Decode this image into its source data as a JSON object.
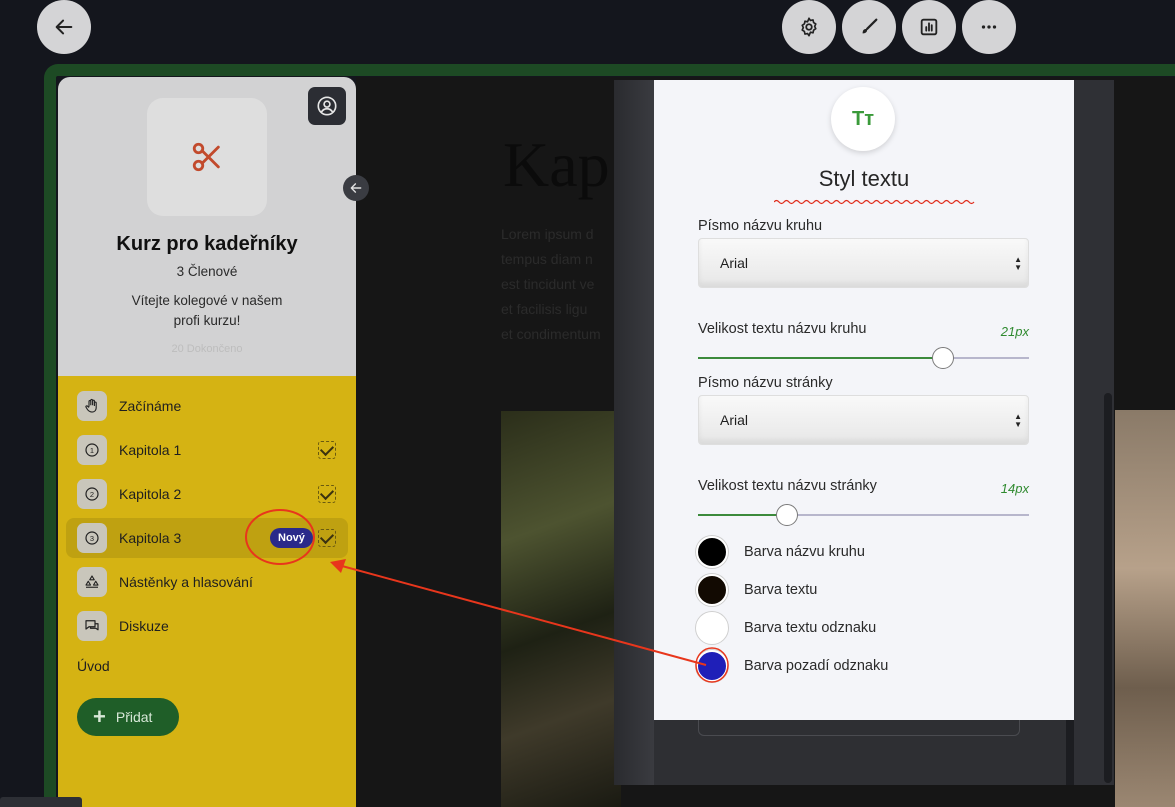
{
  "toolbar": {
    "back_icon": "arrow-left-icon",
    "buttons": [
      {
        "name": "settings-button",
        "icon": "gear-icon"
      },
      {
        "name": "design-button",
        "icon": "brush-icon"
      },
      {
        "name": "stats-button",
        "icon": "chart-icon"
      },
      {
        "name": "more-button",
        "icon": "more-icon"
      }
    ]
  },
  "sidebar": {
    "logo_icon": "scissors-icon",
    "title": "Kurz pro kadeřníky",
    "members": "3 Členové",
    "description": "Vítejte kolegové v našem profi kurzu!",
    "ghost_text": "20 Dokončeno",
    "items": [
      {
        "label": "Začínáme",
        "icon": "hand-icon",
        "checked": false
      },
      {
        "label": "Kapitola 1",
        "icon": "number-1-icon",
        "checked": true
      },
      {
        "label": "Kapitola 2",
        "icon": "number-2-icon",
        "checked": true
      },
      {
        "label": "Kapitola 3",
        "icon": "number-3-icon",
        "checked": true,
        "badge": "Nový",
        "active": true
      },
      {
        "label": "Nástěnky a hlasování",
        "icon": "voting-icon",
        "checked": false
      },
      {
        "label": "Diskuze",
        "icon": "chat-icon",
        "checked": false
      }
    ],
    "section": "Úvod",
    "add_label": "Přidat"
  },
  "content": {
    "title": "Kap",
    "lorem_lines": [
      "Lorem ipsum d",
      "tempus diam n",
      "est tincidunt ve",
      "et facilisis ligu",
      "et condimentum"
    ]
  },
  "modal": {
    "icon_text": "Tт",
    "title": "Styl textu",
    "circle_font_label": "Písmo názvu kruhu",
    "circle_font_value": "Arial",
    "circle_size_label": "Velikost textu názvu kruhu",
    "circle_size_value": "21px",
    "circle_size_fraction": 0.74,
    "page_font_label": "Písmo názvu stránky",
    "page_font_value": "Arial",
    "page_size_label": "Velikost textu názvu stránky",
    "page_size_value": "14px",
    "page_size_fraction": 0.27,
    "colors": [
      {
        "label": "Barva názvu kruhu",
        "color": "#000000"
      },
      {
        "label": "Barva textu",
        "color": "#120a02"
      },
      {
        "label": "Barva textu odznaku",
        "color": "#ffffff"
      },
      {
        "label": "Barva pozadí odznaku",
        "color": "#1f1fb8"
      }
    ]
  },
  "accent_colors": {
    "green": "#1d4a24",
    "yellow": "#d5b313",
    "annotation": "#e8361c"
  }
}
